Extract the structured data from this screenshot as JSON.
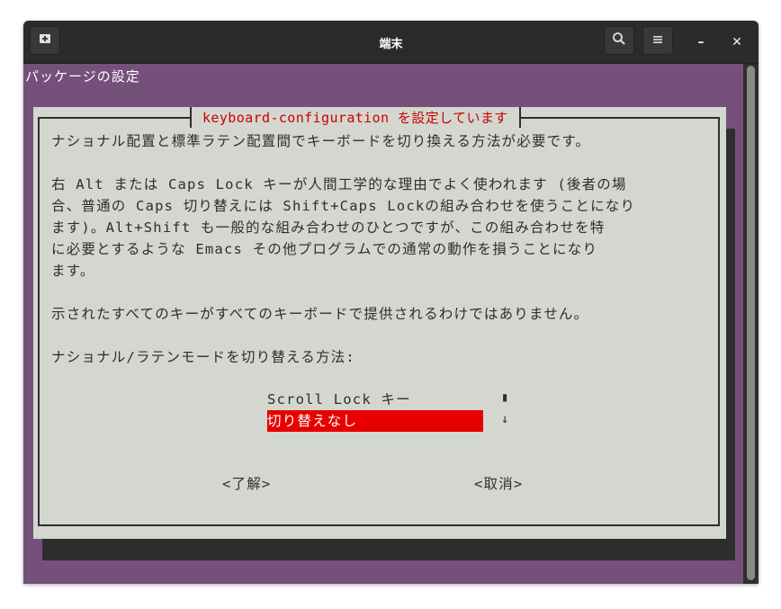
{
  "window": {
    "title": "端末",
    "controls": {
      "minimize": "–",
      "close": "✕"
    }
  },
  "terminal": {
    "header": "パッケージの設定"
  },
  "dialog": {
    "title": "keyboard-configuration を設定しています",
    "paragraphs": [
      "ナショナル配置と標準ラテン配置間でキーボードを切り換える方法が必要です。",
      "右 Alt または Caps Lock キーが人間工学的な理由でよく使われます (後者の場\n合、普通の Caps 切り替えには Shift+Caps Lockの組み合わせを使うことになり\nます)。Alt+Shift も一般的な組み合わせのひとつですが、この組み合わせを特\nに必要とするような Emacs その他プログラムでの通常の動作を損うことになり\nます。",
      "示されたすべてのキーがすべてのキーボードで提供されるわけではありません。",
      "ナショナル/ラテンモードを切り替える方法:"
    ],
    "options": [
      "Scroll Lock キー",
      "切り替えなし"
    ],
    "selected_option": "切り替えなし",
    "scroll_marks": [
      "▮",
      "↓"
    ],
    "buttons": {
      "ok": "<了解>",
      "cancel": "<取消>"
    }
  },
  "colors": {
    "terminal_bg": "#75507b",
    "dialog_bg": "#d3d7cf",
    "title_red": "#cc0000",
    "selection_red": "#e60000",
    "titlebar_bg": "#2b2b2b"
  },
  "icons": [
    "new-tab-icon",
    "search-icon",
    "hamburger-menu-icon",
    "minimize-icon",
    "close-icon"
  ]
}
